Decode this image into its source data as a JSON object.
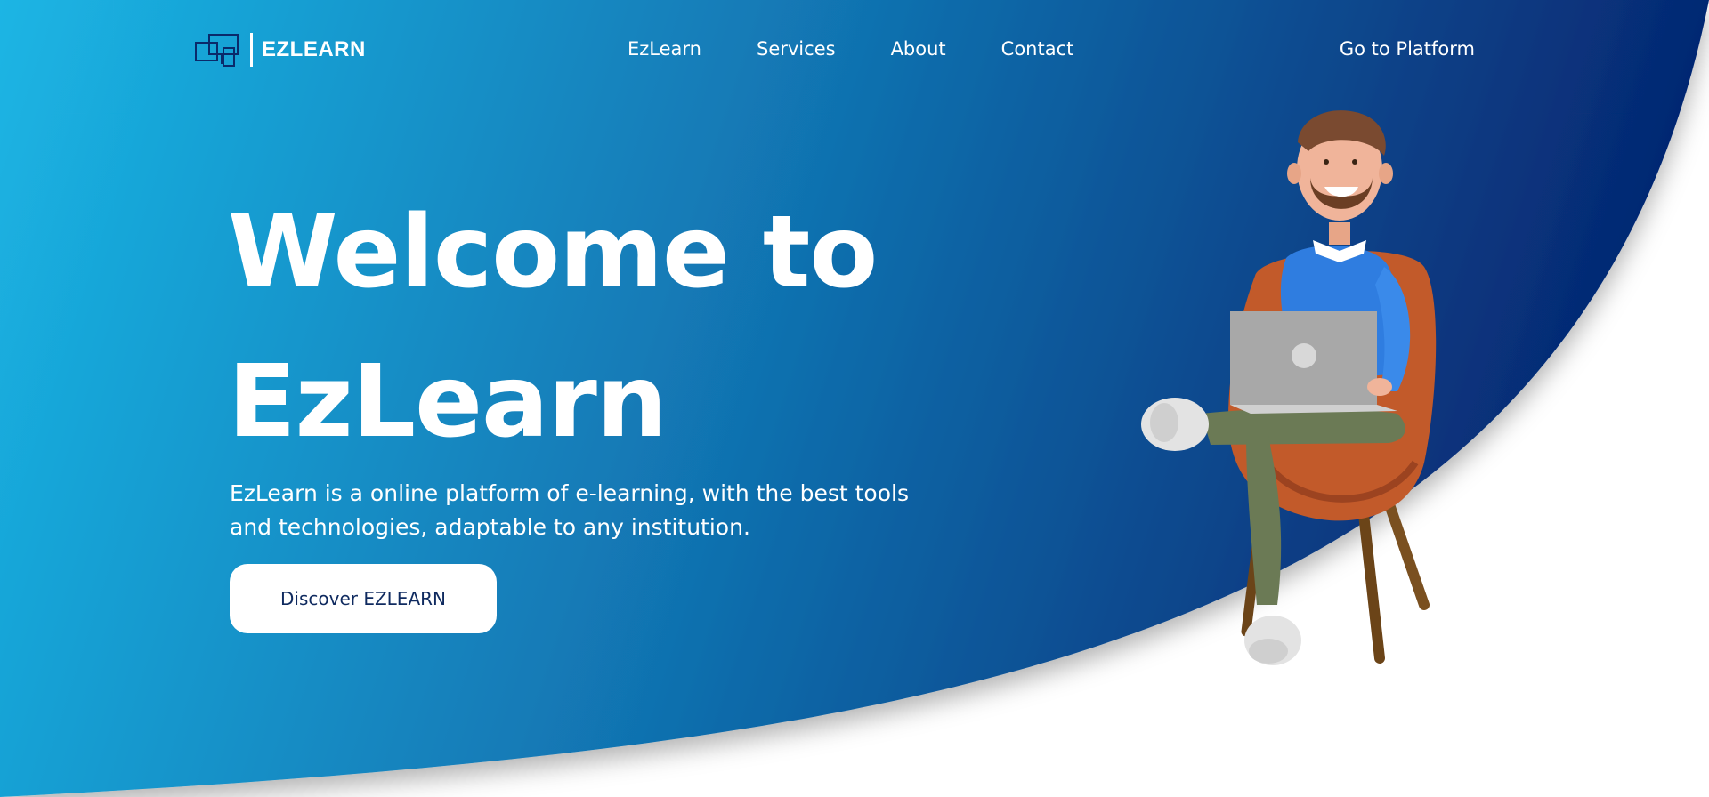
{
  "brand": {
    "name": "EZLEARN",
    "logo_icon": "devices-icon"
  },
  "nav": {
    "items": [
      {
        "label": "EzLearn"
      },
      {
        "label": "Services"
      },
      {
        "label": "About"
      },
      {
        "label": "Contact"
      }
    ],
    "cta_label": "Go to Platform"
  },
  "hero": {
    "title_line1": "Welcome to",
    "title_line2": "EzLearn",
    "description": "EzLearn is a online platform of e-learning, with the best tools and technologies, adaptable to any institution.",
    "button_label": "Discover EZLEARN",
    "illustration": "man-with-laptop-in-chair"
  },
  "colors": {
    "gradient_start": "#1bb3e3",
    "gradient_mid": "#0e5c9c",
    "gradient_end": "#062a70",
    "button_text": "#0f2a5f",
    "background": "#ffffff"
  }
}
